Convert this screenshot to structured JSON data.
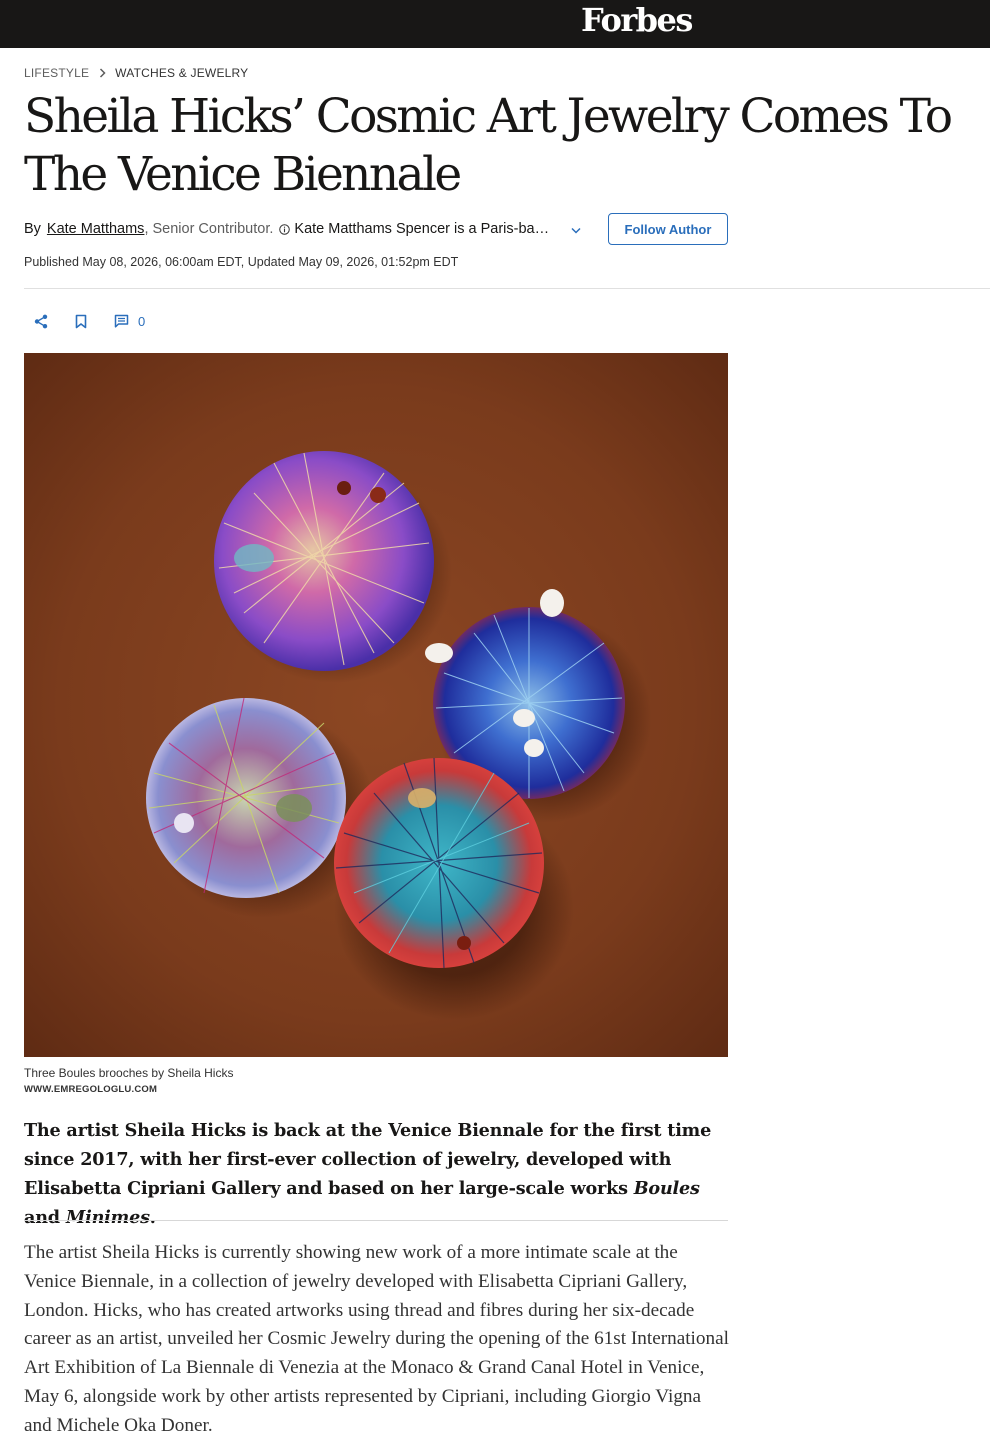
{
  "header": {
    "logo": "Forbes"
  },
  "breadcrumb": {
    "section": "LIFESTYLE",
    "subsection": "WATCHES & JEWELRY"
  },
  "article": {
    "title": "Sheila Hicks’ Cosmic Art Jewelry Comes To The Venice Biennale",
    "byline_prefix": "By",
    "author": "Kate Matthams",
    "author_role": ", Senior Contributor.",
    "author_bio": "Kate Matthams Spencer is a Paris-based journalist",
    "follow_label": "Follow Author",
    "published": "Published May 08, 2026, 06:00am EDT, Updated May 09, 2026, 01:52pm EDT",
    "comment_count": "0",
    "image_caption": "Three Boules brooches by Sheila Hicks",
    "image_credit": "WWW.EMREGOLOGLU.COM",
    "lede_part1": "The artist Sheila Hicks is back at the Venice Biennale for the first time since 2017, with her first-ever collection of jewelry, developed with Elisabetta Cipriani Gallery and based on her large-scale works ",
    "lede_em1": "Boules",
    "lede_and": " and ",
    "lede_em2": "Minimes",
    "lede_end": ".",
    "body_paragraph": "The artist Sheila Hicks is currently showing new work of a more intimate scale at the Venice Biennale, in a collection of jewelry developed with Elisabetta Cipriani Gallery, London. Hicks, who has created artworks using thread and fibres during her six-decade career as an artist, unveiled her Cosmic Jewelry during the opening of the 61st International Art Exhibition of La Biennale di Venezia at the Monaco & Grand Canal Hotel in Venice, May 6, alongside work by other artists represented by Cipriani, including Giorgio Vigna and Michele Oka Doner."
  },
  "icons": {
    "breadcrumb_separator": "chevron-right-icon",
    "bio_info": "info-icon",
    "bio_expand": "chevron-down-icon",
    "share": "share-icon",
    "bookmark": "bookmark-icon",
    "comments": "comment-icon"
  },
  "colors": {
    "topbar": "#181716",
    "accent_blue": "#2a6ebb",
    "text": "#181716",
    "muted": "#5d5d5d",
    "image_background": "#7a3b1e"
  }
}
